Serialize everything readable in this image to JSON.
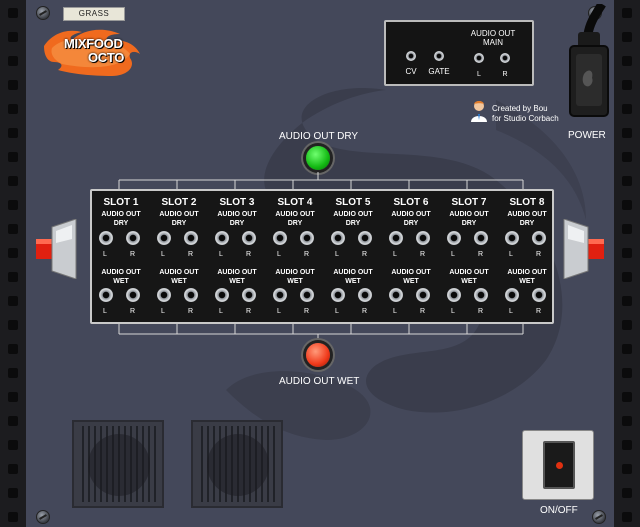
{
  "patch_name": "GRASS",
  "logo": {
    "line1": "MIXFOOD",
    "line2": "OCTO",
    "flame_color": "#f06a1e"
  },
  "outputs_box": {
    "cv_label": "CV",
    "gate_label": "GATE",
    "audio_out_main_label": "AUDIO OUT MAIN",
    "left_label": "L",
    "right_label": "R"
  },
  "credit": {
    "line1": "Created by Bou",
    "line2": "for Studio Corbach"
  },
  "power_label": "POWER",
  "audio_out_dry_label": "AUDIO OUT DRY",
  "audio_out_wet_label": "AUDIO OUT WET",
  "slots": [
    {
      "title": "SLOT 1",
      "dry": "AUDIO OUT DRY",
      "wet": "AUDIO OUT WET",
      "l": "L",
      "r": "R"
    },
    {
      "title": "SLOT 2",
      "dry": "AUDIO OUT DRY",
      "wet": "AUDIO OUT WET",
      "l": "L",
      "r": "R"
    },
    {
      "title": "SLOT 3",
      "dry": "AUDIO OUT DRY",
      "wet": "AUDIO OUT WET",
      "l": "L",
      "r": "R"
    },
    {
      "title": "SLOT 4",
      "dry": "AUDIO OUT DRY",
      "wet": "AUDIO OUT WET",
      "l": "L",
      "r": "R"
    },
    {
      "title": "SLOT 5",
      "dry": "AUDIO OUT DRY",
      "wet": "AUDIO OUT WET",
      "l": "L",
      "r": "R"
    },
    {
      "title": "SLOT 6",
      "dry": "AUDIO OUT DRY",
      "wet": "AUDIO OUT WET",
      "l": "L",
      "r": "R"
    },
    {
      "title": "SLOT 7",
      "dry": "AUDIO OUT DRY",
      "wet": "AUDIO OUT WET",
      "l": "L",
      "r": "R"
    },
    {
      "title": "SLOT 8",
      "dry": "AUDIO OUT DRY",
      "wet": "AUDIO OUT WET",
      "l": "L",
      "r": "R"
    }
  ],
  "onoff_label": "ON/OFF",
  "colors": {
    "panel": "#44485a",
    "dry_lamp": "#13b913",
    "wet_lamp": "#f0391a",
    "handle_tip": "#e02010"
  }
}
